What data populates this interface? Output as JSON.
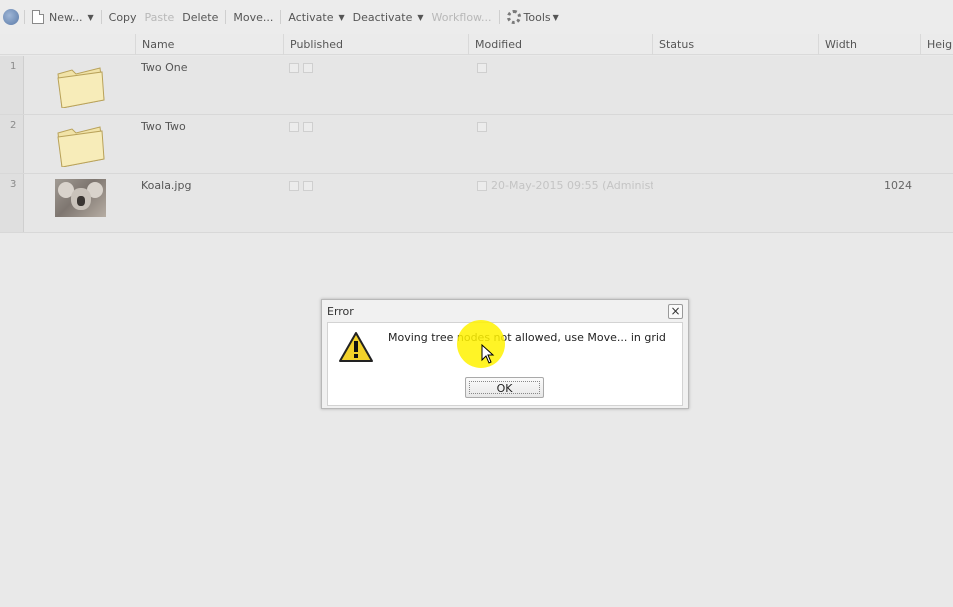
{
  "toolbar": {
    "new_label": "New...",
    "copy_label": "Copy",
    "paste_label": "Paste",
    "delete_label": "Delete",
    "move_label": "Move...",
    "activate_label": "Activate",
    "deactivate_label": "Deactivate",
    "workflow_label": "Workflow...",
    "tools_label": "Tools"
  },
  "grid": {
    "columns": [
      "Name",
      "Published",
      "Modified",
      "Status",
      "Width",
      "Heigh"
    ],
    "rows": [
      {
        "num": "1",
        "name": "Two One",
        "type": "folder",
        "modified": "",
        "width": ""
      },
      {
        "num": "2",
        "name": "Two Two",
        "type": "folder",
        "modified": "",
        "width": ""
      },
      {
        "num": "3",
        "name": "Koala.jpg",
        "type": "image",
        "modified": "20-May-2015 09:55 (Administ",
        "width": "1024"
      }
    ]
  },
  "dialog": {
    "title": "Error",
    "message": "Moving tree nodes not allowed, use Move... in grid",
    "ok_label": "OK",
    "close_label": "×"
  },
  "icons": {
    "refresh": "refresh-icon",
    "new": "page-icon",
    "tools": "gear-icon",
    "warning": "warning-icon",
    "folder": "folder-icon",
    "close": "close-icon"
  }
}
